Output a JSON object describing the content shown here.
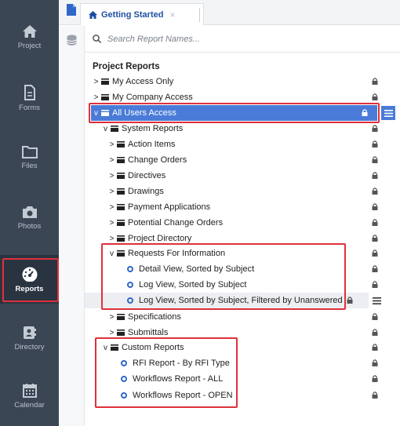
{
  "nav": [
    {
      "id": "project",
      "label": "Project",
      "icon": "home-icon"
    },
    {
      "id": "forms",
      "label": "Forms",
      "icon": "document-icon"
    },
    {
      "id": "files",
      "label": "Files",
      "icon": "folder-icon"
    },
    {
      "id": "photos",
      "label": "Photos",
      "icon": "camera-icon"
    },
    {
      "id": "reports",
      "label": "Reports",
      "icon": "gauge-icon",
      "active": true
    },
    {
      "id": "directory",
      "label": "Directory",
      "icon": "contact-card-icon"
    },
    {
      "id": "calendar",
      "label": "Calendar",
      "icon": "calendar-icon"
    }
  ],
  "tab": {
    "label": "Getting Started",
    "close": "×"
  },
  "search": {
    "placeholder": "Search Report Names..."
  },
  "section_title": "Project Reports",
  "tree": {
    "my_access": "My Access Only",
    "company_access": "My Company Access",
    "all_users": "All Users Access",
    "system_reports": "System Reports",
    "action_items": "Action Items",
    "change_orders": "Change Orders",
    "directives": "Directives",
    "drawings": "Drawings",
    "payment_applications": "Payment Applications",
    "potential_change_orders": "Potential Change Orders",
    "project_directory": "Project Directory",
    "rfi": "Requests For Information",
    "rfi_detail": "Detail View, Sorted by Subject",
    "rfi_log": "Log View, Sorted by Subject",
    "rfi_log_unanswered": "Log View, Sorted by Subject, Filtered by Unanswered",
    "specifications": "Specifications",
    "submittals": "Submittals",
    "custom_reports": "Custom Reports",
    "custom_rfi": "RFI Report - By RFI Type",
    "custom_wf_all": "Workflows Report - ALL",
    "custom_wf_open": "Workflows Report - OPEN"
  },
  "colors": {
    "accent": "#4a7bd8",
    "highlight_box": "#e0303a",
    "nav_bg": "#3a4654"
  }
}
